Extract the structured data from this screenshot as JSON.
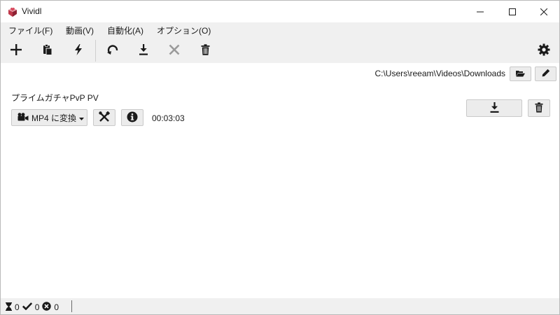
{
  "window": {
    "title": "Vividl",
    "logo_color": "#c0394b"
  },
  "menu": {
    "items": [
      {
        "label": "ファイル(F)"
      },
      {
        "label": "動画(V)"
      },
      {
        "label": "自動化(A)"
      },
      {
        "label": "オプション(O)"
      }
    ]
  },
  "toolbar": {
    "buttons": [
      {
        "icon": "plus-icon"
      },
      {
        "icon": "clipboard-icon"
      },
      {
        "icon": "lightning-icon"
      },
      {
        "icon": "refresh-icon"
      },
      {
        "icon": "download-icon"
      },
      {
        "icon": "cancel-icon"
      },
      {
        "icon": "trash-icon"
      },
      {
        "icon": "gear-icon"
      }
    ],
    "cancel_color": "#9a9a9a"
  },
  "output": {
    "path": "C:\\Users\\reeam\\Videos\\Downloads"
  },
  "video": {
    "title": "プライムガチャPvP PV",
    "convert_label": "MP4 に変換",
    "duration": "00:03:03"
  },
  "status": {
    "pending": "0",
    "done": "0",
    "failed": "0"
  }
}
